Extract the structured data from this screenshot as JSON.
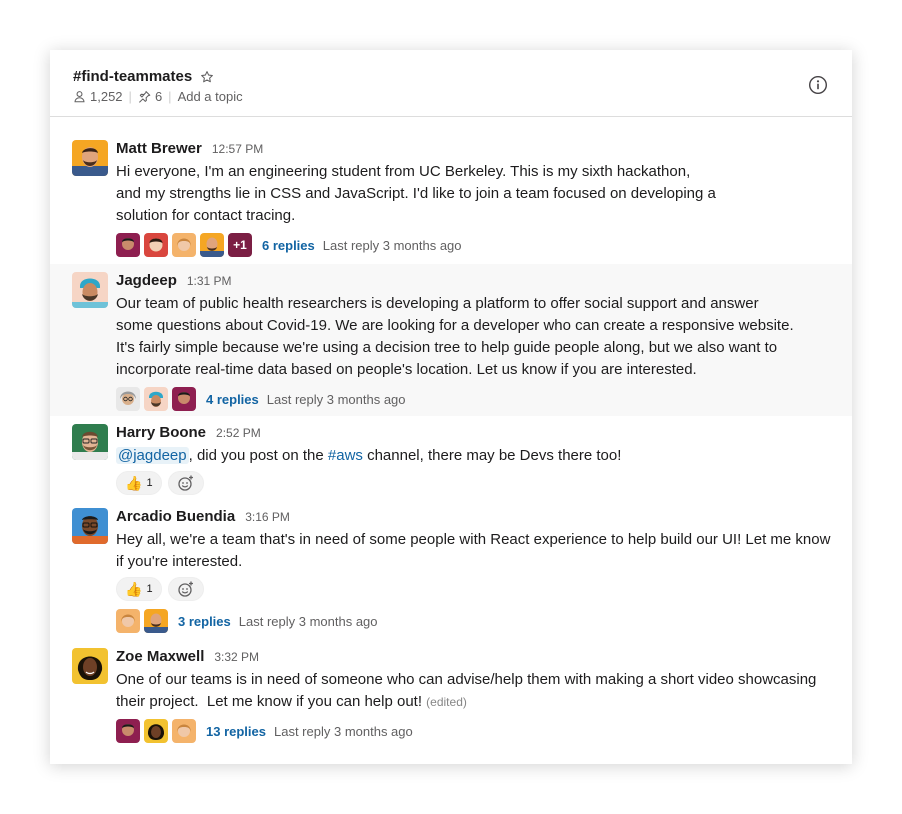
{
  "channel": {
    "name": "#find-teammates",
    "members": "1,252",
    "pins": "6",
    "topic_placeholder": "Add a topic"
  },
  "messages": [
    {
      "author": "Matt Brewer",
      "time": "12:57 PM",
      "lines": [
        "Hi everyone, I'm an engineering student from UC Berkeley. This is my sixth hackathon,",
        "and my strengths lie in CSS and JavaScript. I'd like to join a team focused on developing a",
        "solution for contact tracing."
      ],
      "thread": {
        "more": "+1",
        "replies": "6 replies",
        "last": "Last reply 3 months ago"
      }
    },
    {
      "author": "Jagdeep",
      "time": "1:31 PM",
      "lines": [
        "Our team of public health researchers is developing a platform to offer social support and answer",
        "some questions about Covid-19. We are looking for a developer who can create a responsive website.",
        "It's fairly simple because we're using a decision tree to help guide people along, but we also want to",
        "incorporate real-time data based on people's location. Let us know if you are interested."
      ],
      "thread": {
        "replies": "4 replies",
        "last": "Last reply 3 months ago"
      }
    },
    {
      "author": "Harry Boone",
      "time": "2:52 PM",
      "mention": "@jagdeep",
      "text_a": ", did you post on the ",
      "channel_link": "#aws",
      "text_b": " channel, there may be Devs there too!",
      "reaction": {
        "emoji": "👍",
        "count": "1"
      }
    },
    {
      "author": "Arcadio Buendia",
      "time": "3:16 PM",
      "lines": [
        "Hey all, we're a team that's in need of some people with React experience to help build our UI! Let me know",
        "if you're interested."
      ],
      "reaction": {
        "emoji": "👍",
        "count": "1"
      },
      "thread": {
        "replies": "3 replies",
        "last": "Last reply 3 months ago"
      }
    },
    {
      "author": "Zoe Maxwell",
      "time": "3:32 PM",
      "lines": [
        "One of our teams is in need of someone who can advise/help them with making a short video showcasing",
        "their project.  Let me know if you can help out!"
      ],
      "edited": "(edited)",
      "thread": {
        "replies": "13 replies",
        "last": "Last reply 3 months ago"
      }
    }
  ],
  "colors": {
    "link": "#1264a3",
    "text": "#1d1c1d",
    "muted": "#616061",
    "highlight_row": "#f8f8f8"
  },
  "icons": [
    "star-icon",
    "member-icon",
    "pin-icon",
    "info-icon",
    "add-reaction-icon"
  ]
}
